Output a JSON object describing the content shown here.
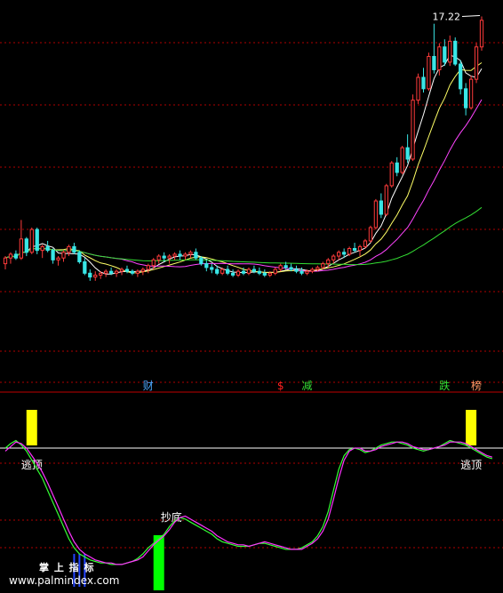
{
  "chart_data": [
    {
      "type": "candlestick",
      "title": "",
      "price_label": "17.22",
      "ylim": [
        0,
        18
      ],
      "colors": {
        "up": "#ff3b3b",
        "down": "#39e6e6",
        "ma5": "#ffffff",
        "ma10": "#ffff66",
        "ma20": "#ff44ff",
        "ma60": "#33dd33",
        "grid": "#b00000"
      },
      "candles": [
        [
          4.6,
          5.0,
          4.3,
          4.9
        ],
        [
          4.9,
          5.2,
          4.6,
          5.1
        ],
        [
          5.1,
          5.3,
          4.8,
          4.9
        ],
        [
          4.9,
          6.9,
          4.8,
          5.9
        ],
        [
          5.9,
          6.0,
          5.0,
          5.2
        ],
        [
          5.2,
          6.5,
          5.1,
          6.4
        ],
        [
          6.4,
          6.5,
          5.1,
          5.3
        ],
        [
          5.3,
          5.6,
          4.9,
          5.5
        ],
        [
          5.5,
          5.8,
          5.2,
          5.3
        ],
        [
          5.3,
          5.4,
          4.6,
          4.8
        ],
        [
          4.8,
          5.0,
          4.5,
          4.9
        ],
        [
          4.9,
          5.3,
          4.7,
          5.2
        ],
        [
          5.2,
          5.6,
          5.0,
          5.5
        ],
        [
          5.5,
          5.7,
          5.1,
          5.2
        ],
        [
          5.2,
          5.3,
          4.6,
          4.7
        ],
        [
          4.7,
          4.9,
          4.0,
          4.1
        ],
        [
          4.1,
          4.3,
          3.7,
          3.9
        ],
        [
          3.9,
          4.2,
          3.7,
          4.0
        ],
        [
          4.0,
          4.2,
          3.8,
          4.1
        ],
        [
          4.1,
          4.3,
          3.9,
          4.2
        ],
        [
          4.2,
          4.4,
          4.0,
          4.1
        ],
        [
          4.1,
          4.3,
          3.9,
          4.2
        ],
        [
          4.2,
          4.4,
          4.0,
          4.3
        ],
        [
          4.3,
          4.5,
          4.1,
          4.2
        ],
        [
          4.2,
          4.3,
          4.0,
          4.1
        ],
        [
          4.1,
          4.3,
          3.9,
          4.2
        ],
        [
          4.2,
          4.4,
          4.0,
          4.3
        ],
        [
          4.3,
          4.6,
          4.1,
          4.5
        ],
        [
          4.5,
          4.9,
          4.3,
          4.8
        ],
        [
          4.8,
          5.1,
          4.6,
          5.0
        ],
        [
          5.0,
          5.2,
          4.7,
          4.9
        ],
        [
          4.9,
          5.1,
          4.6,
          5.0
        ],
        [
          5.0,
          5.2,
          4.8,
          5.1
        ],
        [
          5.1,
          5.3,
          4.8,
          5.0
        ],
        [
          5.0,
          5.2,
          4.8,
          5.1
        ],
        [
          5.1,
          5.3,
          4.9,
          5.2
        ],
        [
          5.2,
          5.4,
          4.8,
          4.9
        ],
        [
          4.9,
          5.0,
          4.5,
          4.6
        ],
        [
          4.6,
          4.8,
          4.2,
          4.4
        ],
        [
          4.4,
          4.6,
          4.1,
          4.3
        ],
        [
          4.3,
          4.5,
          4.0,
          4.1
        ],
        [
          4.1,
          4.4,
          4.0,
          4.3
        ],
        [
          4.3,
          4.5,
          4.0,
          4.1
        ],
        [
          4.1,
          4.3,
          3.9,
          4.0
        ],
        [
          4.0,
          4.3,
          3.9,
          4.2
        ],
        [
          4.2,
          4.4,
          4.0,
          4.1
        ],
        [
          4.1,
          4.4,
          4.0,
          4.3
        ],
        [
          4.3,
          4.5,
          4.1,
          4.2
        ],
        [
          4.2,
          4.4,
          4.0,
          4.1
        ],
        [
          4.1,
          4.3,
          3.9,
          4.0
        ],
        [
          4.0,
          4.2,
          3.9,
          4.1
        ],
        [
          4.1,
          4.4,
          4.0,
          4.3
        ],
        [
          4.3,
          4.6,
          4.2,
          4.5
        ],
        [
          4.5,
          4.7,
          4.3,
          4.4
        ],
        [
          4.4,
          4.6,
          4.2,
          4.3
        ],
        [
          4.3,
          4.5,
          4.1,
          4.2
        ],
        [
          4.2,
          4.4,
          4.0,
          4.1
        ],
        [
          4.1,
          4.3,
          4.0,
          4.2
        ],
        [
          4.2,
          4.4,
          4.1,
          4.3
        ],
        [
          4.3,
          4.5,
          4.2,
          4.4
        ],
        [
          4.4,
          4.7,
          4.3,
          4.6
        ],
        [
          4.6,
          4.9,
          4.4,
          4.8
        ],
        [
          4.8,
          5.1,
          4.6,
          5.0
        ],
        [
          5.0,
          5.3,
          4.8,
          5.2
        ],
        [
          5.2,
          5.4,
          4.9,
          5.1
        ],
        [
          5.1,
          5.5,
          5.0,
          5.4
        ],
        [
          5.4,
          5.7,
          5.2,
          5.3
        ],
        [
          5.3,
          5.6,
          5.0,
          5.5
        ],
        [
          5.5,
          5.9,
          5.4,
          5.8
        ],
        [
          5.8,
          6.6,
          5.7,
          6.5
        ],
        [
          6.5,
          8.0,
          6.4,
          7.9
        ],
        [
          7.9,
          8.3,
          7.0,
          7.2
        ],
        [
          7.2,
          8.8,
          7.1,
          8.7
        ],
        [
          8.7,
          10.0,
          8.6,
          9.9
        ],
        [
          9.9,
          10.2,
          9.2,
          9.4
        ],
        [
          9.4,
          10.8,
          9.3,
          10.7
        ],
        [
          10.7,
          11.4,
          9.9,
          10.1
        ],
        [
          10.1,
          13.5,
          10.0,
          13.2
        ],
        [
          13.2,
          14.6,
          13.0,
          14.4
        ],
        [
          14.4,
          14.9,
          13.6,
          13.8
        ],
        [
          13.8,
          15.7,
          13.7,
          15.5
        ],
        [
          15.5,
          17.22,
          14.6,
          14.8
        ],
        [
          14.8,
          16.2,
          14.5,
          16.0
        ],
        [
          16.0,
          16.4,
          15.0,
          15.2
        ],
        [
          15.2,
          16.6,
          15.0,
          16.3
        ],
        [
          16.3,
          16.5,
          15.0,
          15.1
        ],
        [
          15.1,
          15.3,
          13.5,
          13.8
        ],
        [
          13.8,
          14.1,
          12.4,
          12.8
        ],
        [
          12.8,
          14.5,
          12.7,
          14.3
        ],
        [
          14.3,
          16.2,
          14.1,
          16.0
        ],
        [
          16.0,
          17.6,
          15.8,
          17.4
        ]
      ],
      "ma_periods": [
        5,
        10,
        20,
        60
      ],
      "signal_labels": [
        {
          "text": "财",
          "index": 27,
          "color": "#4aa8ff"
        },
        {
          "text": "$",
          "index": 52,
          "color": "#ff2020"
        },
        {
          "text": "减",
          "index": 57,
          "color": "#33dd33"
        },
        {
          "text": "跌",
          "index": 83,
          "color": "#33dd33"
        },
        {
          "text": "榜",
          "index": 89,
          "color": "#ff9966"
        }
      ]
    },
    {
      "type": "line",
      "title": "",
      "ylim": [
        0,
        100
      ],
      "threshold": 80,
      "colors": {
        "fast": "#33ff33",
        "slow": "#ff33ff",
        "threshold": "#ffffff",
        "top": "#ffff00",
        "bottom": "#00ff00",
        "tick": "#2244ff"
      },
      "series": [
        {
          "key": "fast",
          "values": [
            80,
            83,
            85,
            82,
            78,
            72,
            66,
            60,
            52,
            44,
            36,
            28,
            20,
            14,
            10,
            8,
            6,
            5,
            4,
            4,
            3,
            3,
            3,
            4,
            5,
            7,
            10,
            14,
            17,
            20,
            23,
            28,
            32,
            34,
            33,
            31,
            29,
            27,
            25,
            23,
            20,
            18,
            17,
            16,
            15,
            15,
            15,
            16,
            17,
            17,
            16,
            15,
            14,
            13,
            13,
            13,
            14,
            16,
            18,
            22,
            28,
            38,
            52,
            66,
            75,
            79,
            80,
            79,
            77,
            78,
            80,
            82,
            83,
            84,
            84,
            83,
            82,
            80,
            79,
            78,
            79,
            80,
            81,
            83,
            85,
            84,
            83,
            82,
            80,
            78,
            76,
            74,
            73
          ]
        },
        {
          "key": "slow",
          "values": [
            78,
            81,
            84,
            83,
            80,
            75,
            70,
            64,
            57,
            49,
            41,
            33,
            25,
            18,
            13,
            10,
            8,
            6,
            5,
            4,
            4,
            3,
            3,
            4,
            5,
            6,
            8,
            12,
            16,
            19,
            22,
            26,
            31,
            34,
            35,
            33,
            31,
            29,
            27,
            25,
            22,
            20,
            18,
            17,
            16,
            16,
            15,
            16,
            17,
            18,
            17,
            16,
            15,
            14,
            13,
            13,
            13,
            15,
            17,
            20,
            25,
            33,
            46,
            60,
            72,
            78,
            80,
            80,
            78,
            78,
            79,
            81,
            82,
            83,
            84,
            84,
            83,
            81,
            80,
            79,
            79,
            80,
            81,
            82,
            84,
            84,
            84,
            83,
            81,
            79,
            77,
            75,
            74
          ]
        }
      ],
      "signals": [
        {
          "text": "逃顶",
          "type": "top",
          "index": 5
        },
        {
          "text": "抄底",
          "type": "bottom",
          "index": 29
        },
        {
          "text": "逃顶",
          "type": "top",
          "index": 88
        }
      ],
      "ticks_indices": [
        13,
        14,
        15
      ]
    }
  ],
  "watermark": {
    "line1": "掌 上 指 标",
    "line2": "www.palmindex.com"
  }
}
